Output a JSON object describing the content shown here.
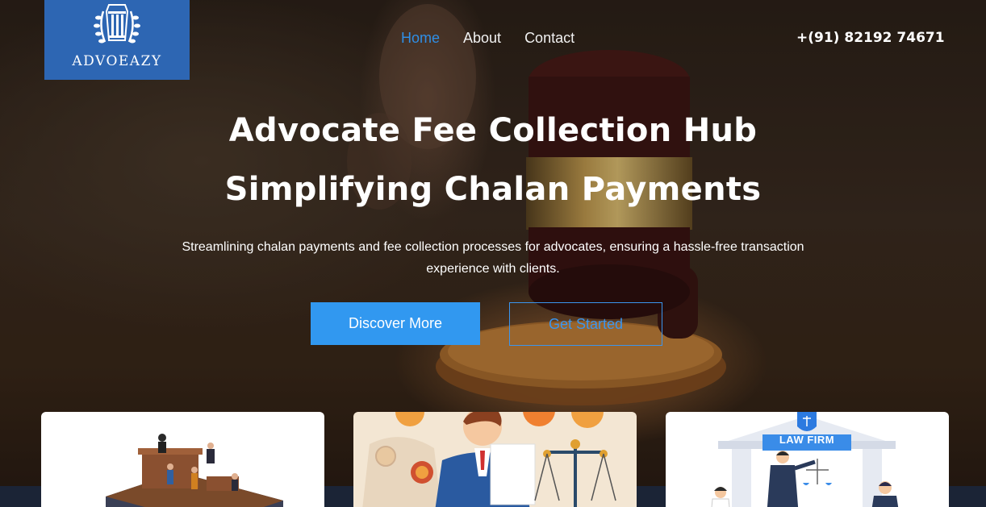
{
  "brand": {
    "name": "ADVOEAZY",
    "bg_color": "#2d66b3"
  },
  "nav": {
    "items": [
      {
        "label": "Home",
        "active": true
      },
      {
        "label": "About",
        "active": false
      },
      {
        "label": "Contact",
        "active": false
      }
    ],
    "active_color": "#2f8fe6"
  },
  "contact": {
    "phone": "+(91) 82192 74671"
  },
  "hero": {
    "title_line1": "Advocate Fee Collection Hub",
    "title_line2": "Simplifying Chalan Payments",
    "subtitle": "Streamlining chalan payments and fee collection processes for advocates, ensuring a hassle-free transaction experience with clients.",
    "primary_button": "Discover More",
    "secondary_button": "Get Started",
    "accent_color": "#3198f0"
  },
  "cards": [
    {
      "illustration": "courtroom-illustration"
    },
    {
      "illustration": "lawyer-documents-illustration"
    },
    {
      "illustration": "law-firm-illustration",
      "sign_text": "LAW FIRM"
    }
  ]
}
